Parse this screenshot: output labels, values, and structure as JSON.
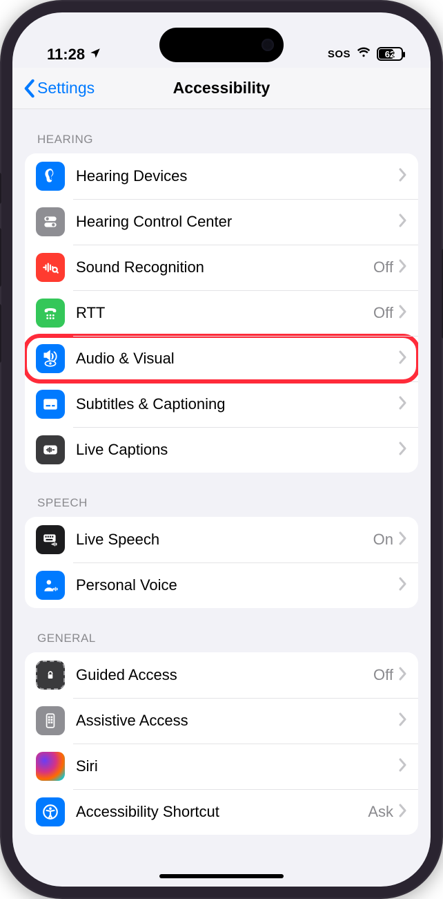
{
  "status": {
    "time": "11:28",
    "sos": "SOS",
    "battery_pct": "62"
  },
  "nav": {
    "back": "Settings",
    "title": "Accessibility"
  },
  "sections": {
    "hearing": {
      "header": "HEARING",
      "items": [
        {
          "label": "Hearing Devices",
          "value": ""
        },
        {
          "label": "Hearing Control Center",
          "value": ""
        },
        {
          "label": "Sound Recognition",
          "value": "Off"
        },
        {
          "label": "RTT",
          "value": "Off"
        },
        {
          "label": "Audio & Visual",
          "value": ""
        },
        {
          "label": "Subtitles & Captioning",
          "value": ""
        },
        {
          "label": "Live Captions",
          "value": ""
        }
      ]
    },
    "speech": {
      "header": "SPEECH",
      "items": [
        {
          "label": "Live Speech",
          "value": "On"
        },
        {
          "label": "Personal Voice",
          "value": ""
        }
      ]
    },
    "general": {
      "header": "GENERAL",
      "items": [
        {
          "label": "Guided Access",
          "value": "Off"
        },
        {
          "label": "Assistive Access",
          "value": ""
        },
        {
          "label": "Siri",
          "value": ""
        },
        {
          "label": "Accessibility Shortcut",
          "value": "Ask"
        }
      ]
    }
  }
}
